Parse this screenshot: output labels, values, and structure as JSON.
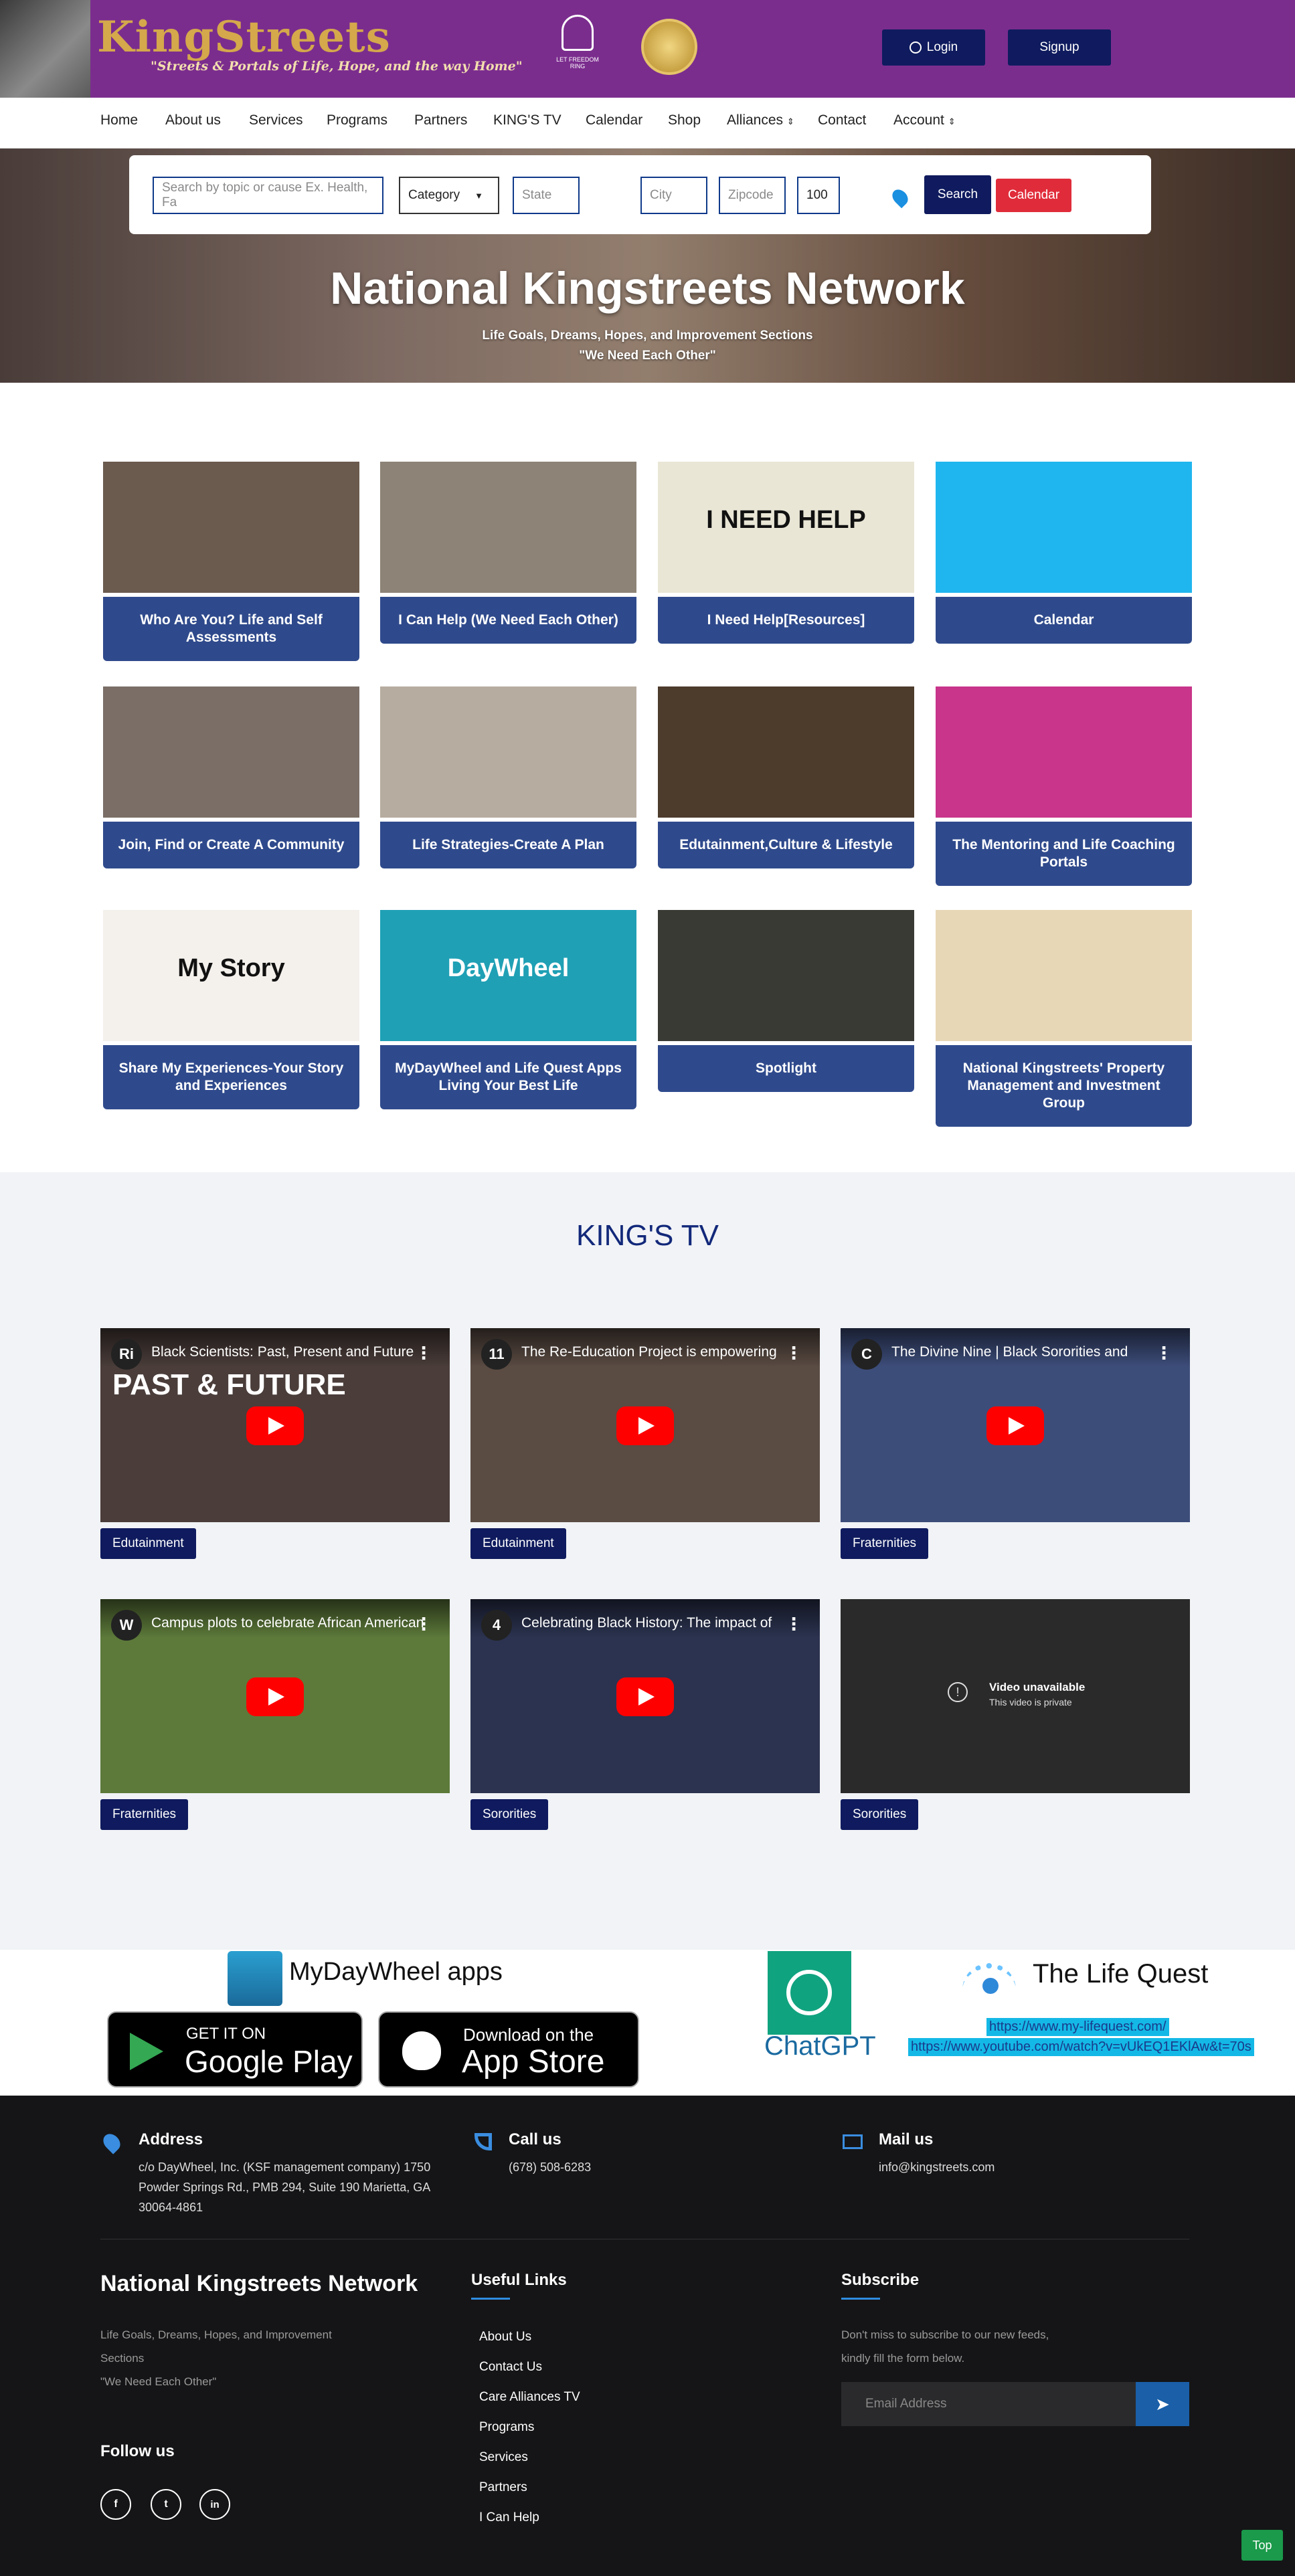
{
  "header": {
    "logo_text": "KingStreets",
    "logo_tagline": "\"Streets & Portals of Life, Hope, and the way Home\"",
    "bell_caption": "LET FREEDOM RING",
    "login_label": "Login",
    "signup_label": "Signup"
  },
  "nav": {
    "items": [
      "Home",
      "About us",
      "Services",
      "Programs",
      "Partners",
      "KING'S TV",
      "Calendar",
      "Shop",
      "Alliances",
      "Contact",
      "Account"
    ]
  },
  "search": {
    "query_placeholder": "Search by topic or cause Ex. Health, Fa",
    "category_value": "Category",
    "state_placeholder": "State",
    "city_placeholder": "City",
    "zipcode_placeholder": "Zipcode",
    "radius_value": "100",
    "search_label": "Search",
    "calendar_label": "Calendar"
  },
  "hero": {
    "title": "National Kingstreets Network",
    "subtitle": "Life Goals, Dreams, Hopes, and Improvement Sections",
    "quote": "\"We Need Each Other\""
  },
  "cards": [
    {
      "label": "Who Are You? Life and Self Assessments",
      "color": "#6b5a4e"
    },
    {
      "label": "I Can Help (We Need Each Other)",
      "color": "#8d8377"
    },
    {
      "label": "I Need Help[Resources]",
      "color": "#e9e6d6",
      "img_text": "I NEED HELP"
    },
    {
      "label": "Calendar",
      "color": "#1fb6ef"
    },
    {
      "label": "Join, Find or Create A Community",
      "color": "#7a6e66"
    },
    {
      "label": "Life Strategies-Create A Plan",
      "color": "#b7aca0"
    },
    {
      "label": "Edutainment,Culture & Lifestyle",
      "color": "#4d3b2b"
    },
    {
      "label": "The Mentoring and Life Coaching Portals",
      "color": "#c8358a"
    },
    {
      "label": "Share My Experiences-Your Story and Experiences",
      "color": "#f4f1ec",
      "img_text": "My Story"
    },
    {
      "label": "MyDayWheel and Life Quest Apps Living Your Best Life",
      "color": "#1fa0b5",
      "img_text": "DayWheel"
    },
    {
      "label": "Spotlight",
      "color": "#3a3a35"
    },
    {
      "label": "National Kingstreets' Property Management and Investment Group",
      "color": "#e8d7b6"
    }
  ],
  "tv": {
    "heading": "KING'S TV",
    "videos": [
      {
        "title": "Black Scientists: Past, Present and Future",
        "channel": "Ri",
        "tag": "Edutainment",
        "bg": "#4a3d3a",
        "overlay": "PAST & FUTURE"
      },
      {
        "title": "The Re-Education Project is empowering",
        "channel": "11",
        "tag": "Edutainment",
        "bg": "#5a4b43"
      },
      {
        "title": "The Divine Nine | Black Sororities and",
        "channel": "C",
        "tag": "Fraternities",
        "bg": "#3d4d7a"
      },
      {
        "title": "Campus plots to celebrate African American",
        "channel": "W",
        "tag": "Fraternities",
        "bg": "#5d7a3a"
      },
      {
        "title": "Celebrating Black History: The impact of",
        "channel": "4",
        "tag": "Sororities",
        "bg": "#2b3350"
      },
      {
        "title": "",
        "channel": "",
        "tag": "Sororities",
        "bg": "#2a2a2a",
        "unavailable": "Video unavailable",
        "unavailable_sub": "This video is private"
      }
    ]
  },
  "apps": {
    "daywheel_title": "MyDayWheel apps",
    "google_small": "GET IT ON",
    "google_big": "Google Play",
    "apple_small": "Download on the",
    "apple_big": "App Store",
    "chatgpt_label": "ChatGPT",
    "lifequest_title": "The Life Quest",
    "lifequest_url": "https://www.my-lifequest.com/",
    "youtube_url": "https://www.youtube.com/watch?v=vUkEQ1EKlAw&t=70s"
  },
  "footer": {
    "address_title": "Address",
    "address_text": "c/o DayWheel, Inc. (KSF management company) 1750 Powder Springs Rd., PMB 294, Suite 190 Marietta, GA 30064-4861",
    "call_title": "Call us",
    "call_text": "(678) 508-6283",
    "mail_title": "Mail us",
    "mail_text": "info@kingstreets.com",
    "brand_title": "National Kingstreets Network",
    "brand_line1": "Life Goals, Dreams, Hopes, and Improvement",
    "brand_line2": "Sections",
    "brand_line3": "\"We Need Each Other\"",
    "follow_title": "Follow us",
    "links_title": "Useful Links",
    "links": [
      "About Us",
      "Contact Us",
      "Care Alliances TV",
      "Programs",
      "Services",
      "Partners",
      "I Can Help"
    ],
    "subscribe_title": "Subscribe",
    "subscribe_line1": "Don't miss to subscribe to our new feeds,",
    "subscribe_line2": "kindly fill the form below.",
    "email_placeholder": "Email Address",
    "top_label": "Top"
  },
  "colors": {
    "header": "#7b2d8e",
    "navy": "#0f1b5e",
    "card": "#2f4a8c",
    "footer": "#151517",
    "calendar_btn": "#e02c3a"
  }
}
